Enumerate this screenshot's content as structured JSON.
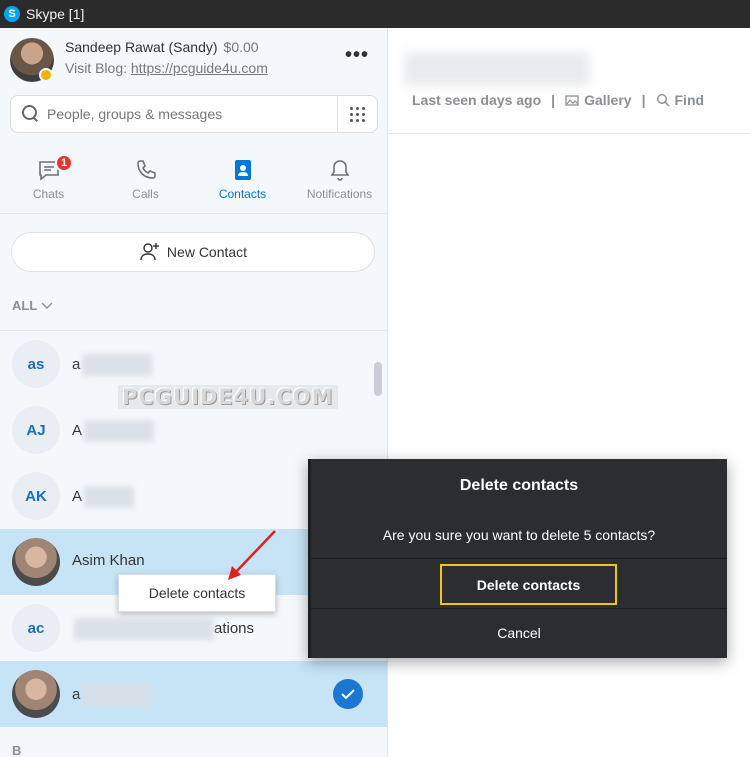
{
  "window": {
    "app_logo": "S",
    "title": "Skype [1]"
  },
  "profile": {
    "name": "Sandeep Rawat (Sandy)",
    "credit": "$0.00",
    "blog_label": "Visit Blog:",
    "blog_link": "https://pcguide4u.com",
    "more_label": "•••"
  },
  "search": {
    "placeholder": "People, groups & messages"
  },
  "tabs": [
    {
      "label": "Chats",
      "badge": "1",
      "icon": "chat-icon"
    },
    {
      "label": "Calls",
      "icon": "phone-icon"
    },
    {
      "label": "Contacts",
      "icon": "contacts-icon",
      "active": true
    },
    {
      "label": "Notifications",
      "icon": "bell-icon"
    }
  ],
  "new_contact_label": "New Contact",
  "filter": {
    "label": "ALL"
  },
  "contacts": [
    {
      "initials": "as",
      "name": "a",
      "selected": false
    },
    {
      "initials": "AJ",
      "name": "A",
      "selected": false
    },
    {
      "initials": "AK",
      "name": "A",
      "selected": false
    },
    {
      "initials": "",
      "name": "Asim Khan",
      "photo": true,
      "selected": true
    },
    {
      "initials": "ac",
      "name": "ations",
      "selected": false
    },
    {
      "initials": "",
      "name": "a",
      "photo": true,
      "selected": true,
      "checked": true
    }
  ],
  "section_letter": "B",
  "watermark": "PCGUIDE4U.COM",
  "context_menu": {
    "item": "Delete contacts"
  },
  "chat": {
    "last_seen": "Last seen days ago",
    "gallery": "Gallery",
    "find": "Find",
    "separator": "|"
  },
  "dialog": {
    "title": "Delete contacts",
    "message": "Are you sure you want to delete 5 contacts?",
    "confirm": "Delete contacts",
    "cancel": "Cancel"
  },
  "colors": {
    "accent": "#0078d4",
    "selected_row": "#c7e4f7",
    "dialog_bg": "#2b2d31",
    "highlight": "#f0c419",
    "badge": "#e3342f"
  }
}
